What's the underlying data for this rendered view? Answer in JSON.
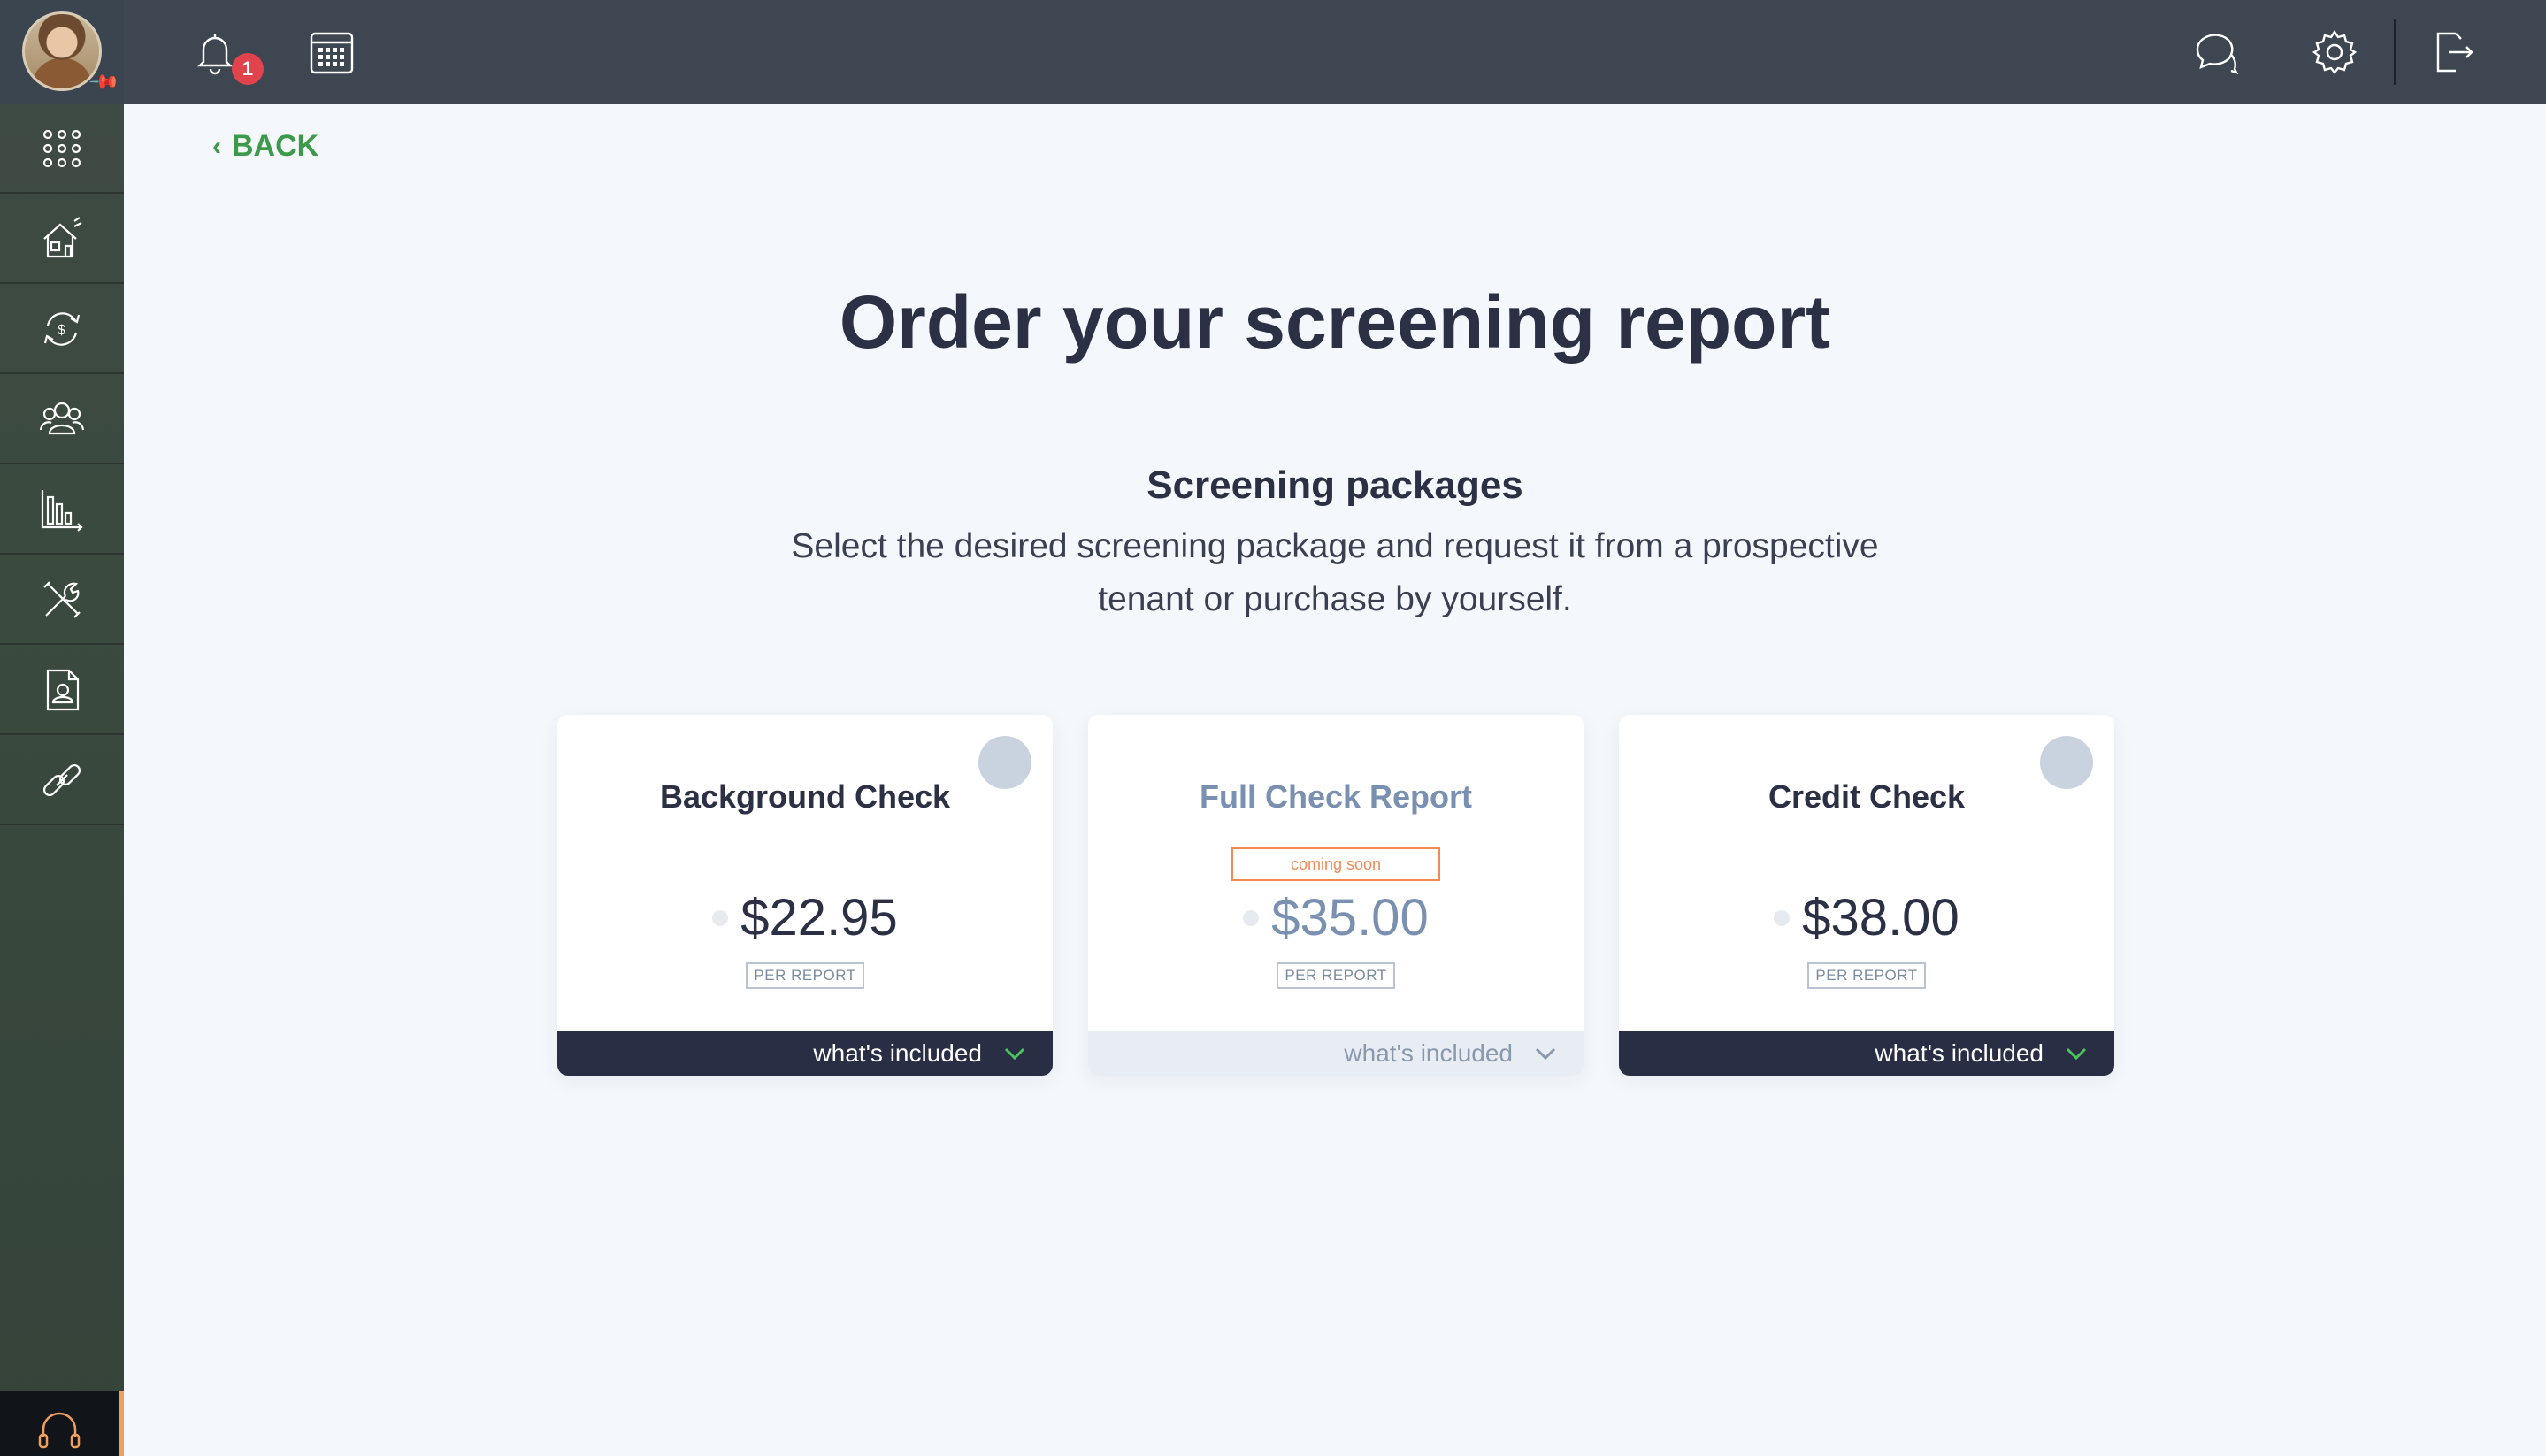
{
  "topbar": {
    "notifications_count": "1",
    "icons": [
      "bell-icon",
      "calendar-icon",
      "chat-icon",
      "gear-icon",
      "logout-icon"
    ]
  },
  "sidebar": {
    "items": [
      "apps-grid-icon",
      "house-icon",
      "dollar-cycle-icon",
      "people-icon",
      "chart-icon",
      "tools-icon",
      "contact-document-icon",
      "link-icon"
    ],
    "support_icon": "headset-icon"
  },
  "nav": {
    "back_label": "BACK"
  },
  "page": {
    "title": "Order your screening report",
    "section_title": "Screening packages",
    "section_desc": "Select the desired screening package and request it from a prospective tenant or purchase by yourself."
  },
  "packages": [
    {
      "name": "Background Check",
      "price": "$22.95",
      "per": "PER REPORT",
      "footer": "what's included",
      "status": ""
    },
    {
      "name": "Full Check Report",
      "price": "$35.00",
      "per": "PER REPORT",
      "footer": "what's included",
      "status": "coming soon"
    },
    {
      "name": "Credit Check",
      "price": "$38.00",
      "per": "PER REPORT",
      "footer": "what's included",
      "status": ""
    }
  ],
  "colors": {
    "accent_green": "#3d9a4a",
    "dark_navy": "#292e44",
    "coming_soon": "#ef8a55",
    "badge_red": "#e0434b"
  }
}
